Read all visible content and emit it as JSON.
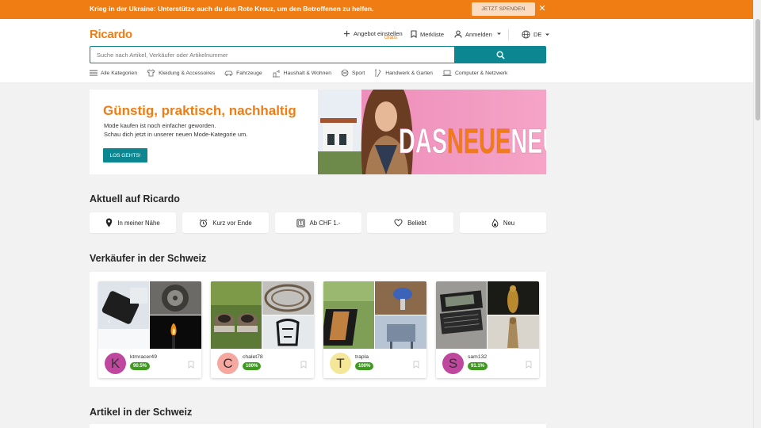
{
  "banner": {
    "text": "Krieg in der Ukraine: Unterstütze auch du das Rote Kreuz, um den Betroffenen zu helfen.",
    "donate_label": "JETZT SPENDEN",
    "close_icon": "close-icon",
    "color": "#f07d14"
  },
  "header": {
    "logo": "Ricardo",
    "sell_label": "Angebot einstellen",
    "sell_sub": "Gratis",
    "watchlist_label": "Merkliste",
    "login_label": "Anmelden",
    "language": "DE"
  },
  "search": {
    "placeholder": "Suche nach Artikel, Verkäufer oder Artikelnummer",
    "value": "",
    "button_icon": "search-icon"
  },
  "categories": [
    {
      "label": "Alle Kategorien",
      "icon": "menu-icon"
    },
    {
      "label": "Kleidung & Accessoires",
      "icon": "shirt-icon"
    },
    {
      "label": "Fahrzeuge",
      "icon": "car-icon"
    },
    {
      "label": "Haushalt & Wohnen",
      "icon": "lamp-icon"
    },
    {
      "label": "Sport",
      "icon": "ball-icon"
    },
    {
      "label": "Handwerk & Garten",
      "icon": "tools-icon"
    },
    {
      "label": "Computer & Netzwerk",
      "icon": "laptop-icon"
    }
  ],
  "hero": {
    "title": "Günstig, praktisch, nachhaltig",
    "line1": "Mode kaufen ist noch einfacher geworden.",
    "line2": "Schau dich jetzt in unserer neuen Mode-Kategorie um.",
    "button": "LOS GEHTS!",
    "image_text_1": "DAS",
    "image_text_2": "NEUE",
    "image_text_3": "NEU"
  },
  "aktuell": {
    "title": "Aktuell auf Ricardo",
    "items": [
      {
        "label": "In meiner Nähe",
        "icon": "location-icon"
      },
      {
        "label": "Kurz vor Ende",
        "icon": "alarm-icon"
      },
      {
        "label": "Ab CHF 1.-",
        "icon": "one-franc-icon"
      },
      {
        "label": "Beliebt",
        "icon": "heart-icon"
      },
      {
        "label": "Neu",
        "icon": "flame-icon"
      }
    ]
  },
  "sellers": {
    "title": "Verkäufer in der Schweiz",
    "items": [
      {
        "initial": "K",
        "name": "ktmracer49",
        "rating": "90.5%",
        "avatar_color": "#c0479e"
      },
      {
        "initial": "C",
        "name": "chalet78",
        "rating": "100%",
        "avatar_color": "#f6a8a0"
      },
      {
        "initial": "T",
        "name": "trapla",
        "rating": "100%",
        "avatar_color": "#f5e79a"
      },
      {
        "initial": "S",
        "name": "sam132",
        "rating": "91.1%",
        "avatar_color": "#c0479e"
      }
    ]
  },
  "articles": {
    "title": "Artikel in der Schweiz"
  },
  "colors": {
    "brand_orange": "#f07d14",
    "teal": "#0c8791",
    "rating_green": "#3e9b1f"
  }
}
